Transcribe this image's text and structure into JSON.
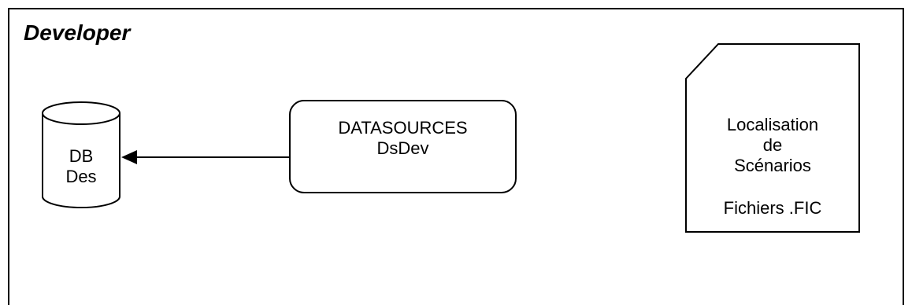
{
  "title": "Developer",
  "database": {
    "line1": "DB",
    "line2": "Des"
  },
  "datasource": {
    "line1": "DATASOURCES",
    "line2": "DsDev"
  },
  "document": {
    "line1": "Localisation",
    "line2": "de",
    "line3": "Scénarios",
    "files": "Fichiers .FIC"
  }
}
